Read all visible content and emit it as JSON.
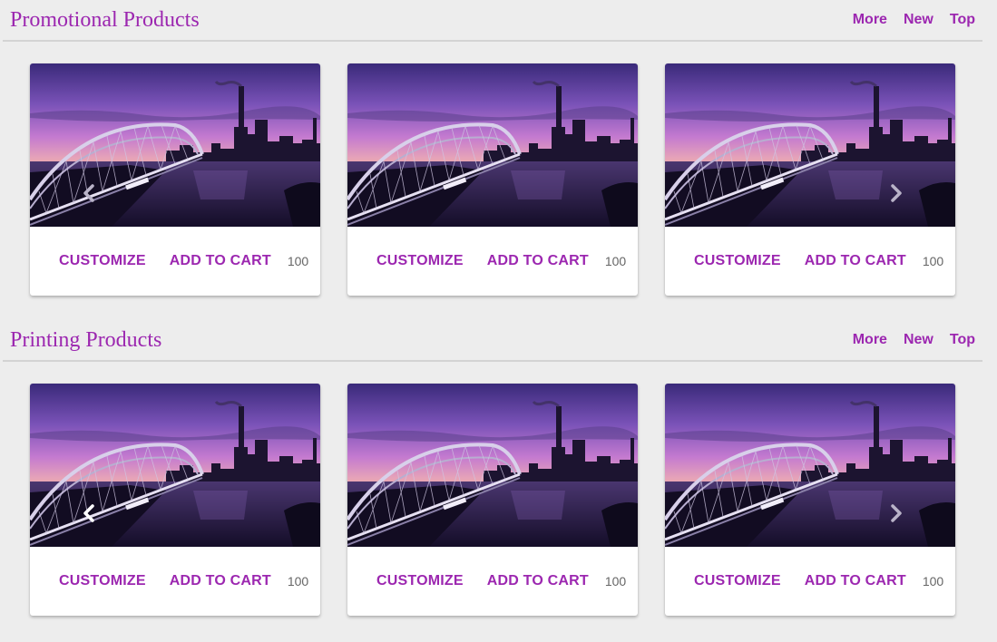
{
  "colors": {
    "accent": "#9c27b0",
    "background": "#ededed",
    "card": "#ffffff",
    "muted_text": "#666666"
  },
  "sections": [
    {
      "title": "Promotional Products",
      "links": [
        "More",
        "New",
        "Top"
      ],
      "cards": [
        {
          "customize_label": "CUSTOMIZE",
          "cart_label": "ADD TO CART",
          "count": "100",
          "arrow": "chevron-left-icon"
        },
        {
          "customize_label": "CUSTOMIZE",
          "cart_label": "ADD TO CART",
          "count": "100",
          "arrow": ""
        },
        {
          "customize_label": "CUSTOMIZE",
          "cart_label": "ADD TO CART",
          "count": "100",
          "arrow": "chevron-right-icon"
        }
      ]
    },
    {
      "title": "Printing Products",
      "links": [
        "More",
        "New",
        "Top"
      ],
      "cards": [
        {
          "customize_label": "CUSTOMIZE",
          "cart_label": "ADD TO CART",
          "count": "100",
          "arrow": "chevron-left-icon"
        },
        {
          "customize_label": "CUSTOMIZE",
          "cart_label": "ADD TO CART",
          "count": "100",
          "arrow": ""
        },
        {
          "customize_label": "CUSTOMIZE",
          "cart_label": "ADD TO CART",
          "count": "100",
          "arrow": "chevron-right-icon"
        }
      ]
    }
  ]
}
